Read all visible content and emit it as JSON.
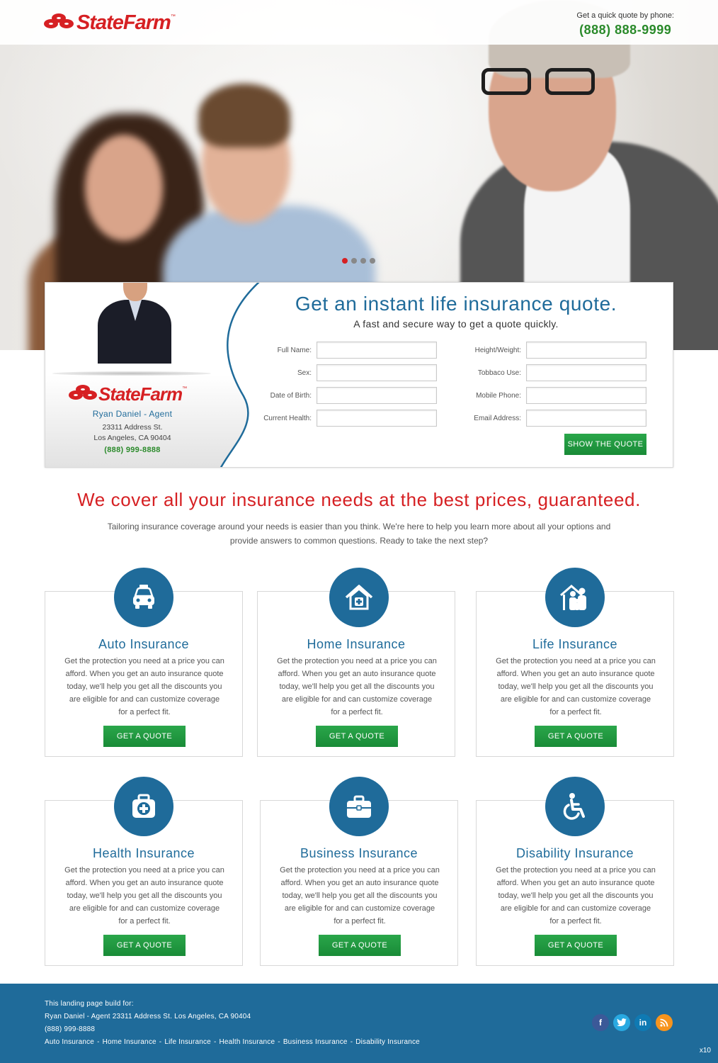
{
  "brand": {
    "name": "StateFarm",
    "tm": "™"
  },
  "header": {
    "phone_label": "Get a quick quote by phone:",
    "phone_number": "(888) 888-9999"
  },
  "hero": {
    "slides": 4,
    "active_slide": 1
  },
  "agent": {
    "name": "Ryan Daniel - Agent",
    "address_line1": "23311 Address St.",
    "address_line2": "Los Angeles, CA 90404",
    "phone": "(888) 999-8888"
  },
  "quote_form": {
    "title": "Get an instant life insurance quote.",
    "subtitle": "A fast and secure way to get a quote quickly.",
    "fields": [
      {
        "label": "Full Name:",
        "value": ""
      },
      {
        "label": "Sex:",
        "value": ""
      },
      {
        "label": "Date of Birth:",
        "value": ""
      },
      {
        "label": "Current Health:",
        "value": ""
      },
      {
        "label": "Height/Weight:",
        "value": ""
      },
      {
        "label": "Tobbaco Use:",
        "value": ""
      },
      {
        "label": "Mobile Phone:",
        "value": ""
      },
      {
        "label": "Email Address:",
        "value": ""
      }
    ],
    "submit_label": "SHOW THE QUOTE"
  },
  "coverage": {
    "title": "We cover all your insurance needs at the best prices, guaranteed.",
    "description": "Tailoring insurance coverage around your needs is easier than you think. We're here to help you learn more about all your options and provide answers to common questions. Ready to take the next step?"
  },
  "cards": [
    {
      "title": "Auto Insurance",
      "icon": "car-icon",
      "text": "Get the protection you need at a price you can afford. When you get an auto insurance quote today, we'll help you get all the discounts you are eligible for and can customize coverage for a perfect fit.",
      "button": "GET A QUOTE"
    },
    {
      "title": "Home Insurance",
      "icon": "home-icon",
      "text": "Get the protection you need at a price you can afford. When you get an auto insurance quote today, we'll help you get all the discounts you are eligible for and can customize coverage for a perfect fit.",
      "button": "GET A QUOTE"
    },
    {
      "title": "Life Insurance",
      "icon": "family-icon",
      "text": "Get the protection you need at a price you can afford. When you get an auto insurance quote today, we'll help you get all the discounts you are eligible for and can customize coverage for a perfect fit.",
      "button": "GET A QUOTE"
    },
    {
      "title": "Health Insurance",
      "icon": "medical-kit-icon",
      "text": "Get the protection you need at a price you can afford. When you get an auto insurance quote today, we'll help you get all the discounts you are eligible for and can customize coverage for a perfect fit.",
      "button": "GET A QUOTE"
    },
    {
      "title": "Business Insurance",
      "icon": "briefcase-icon",
      "text": "Get the protection you need at a price you can afford. When you get an auto insurance quote today, we'll help you get all the discounts you are eligible for and can customize coverage for a perfect fit.",
      "button": "GET A QUOTE"
    },
    {
      "title": "Disability Insurance",
      "icon": "wheelchair-icon",
      "text": "Get the protection you need at a price you can afford. When you get an auto insurance quote today, we'll help you get all the discounts you are eligible for and can customize coverage for a perfect fit.",
      "button": "GET A QUOTE"
    }
  ],
  "footer": {
    "line1": "This landing page build for:",
    "line2": "Ryan Daniel - Agent 23311 Address St. Los Angeles, CA 90404",
    "line3": "(888) 999-8888",
    "links": [
      "Auto Insurance",
      "Home Insurance",
      "Life Insurance",
      "Health Insurance",
      "Business Insurance",
      "Disability Insurance"
    ],
    "link_separator": "-",
    "socials": [
      "facebook-icon",
      "twitter-icon",
      "linkedin-icon",
      "rss-icon"
    ],
    "corner_text": "x10"
  },
  "colors": {
    "brand_red": "#d62023",
    "primary_blue": "#1f6b9a",
    "cta_green": "#1f9a40",
    "phone_green": "#2a8a2a"
  }
}
